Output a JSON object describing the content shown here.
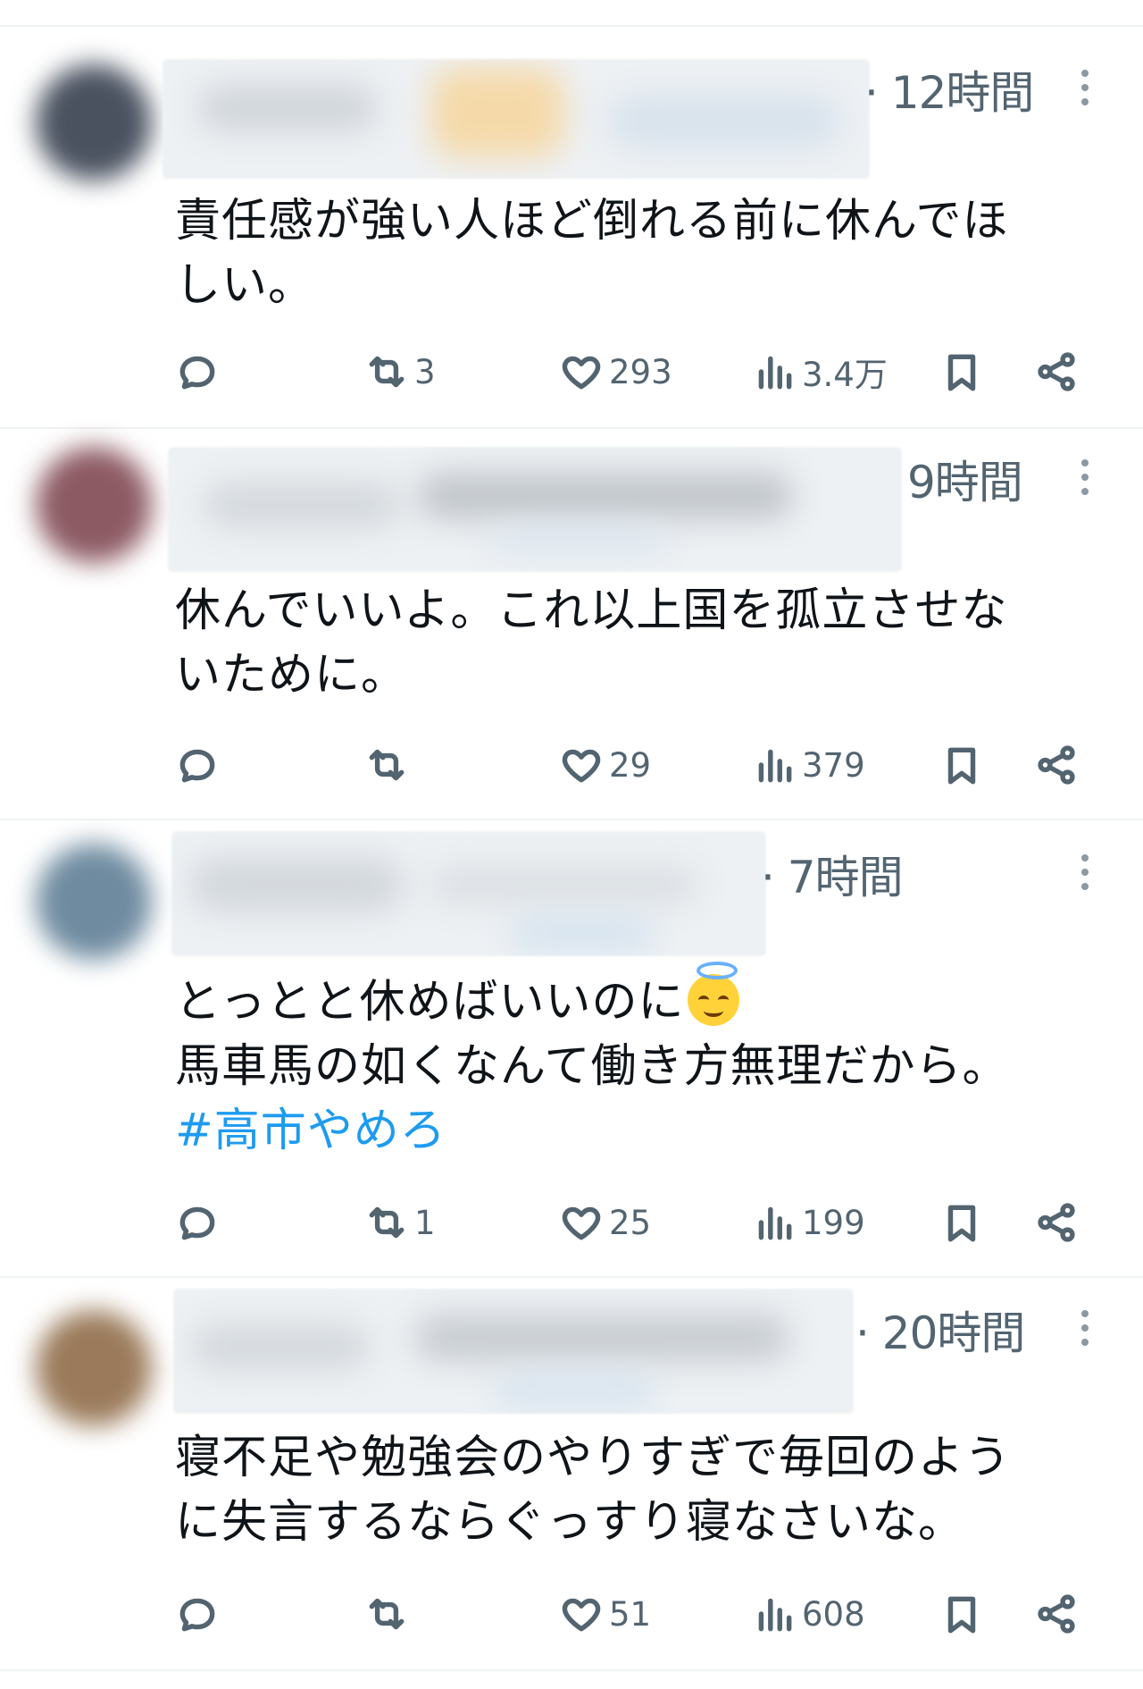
{
  "tweets": [
    {
      "time": "· 12時間",
      "lines": [
        "責任感が強い人ほど倒れる前に休んでほ",
        "しい。"
      ],
      "hashtag": "",
      "replies": "",
      "retweets": "3",
      "likes": "293",
      "views": "3.4万"
    },
    {
      "time": "9時間",
      "lines": [
        "休んでいいよ。これ以上国を孤立させな",
        "いために。"
      ],
      "hashtag": "",
      "replies": "",
      "retweets": "",
      "likes": "29",
      "views": "379"
    },
    {
      "time": "· 7時間",
      "lines": [
        "とっとと休めばいいのに",
        "馬車馬の如くなんて働き方無理だから。"
      ],
      "emoji": "smiling-face-with-halo",
      "hashtag": "#高市やめろ",
      "replies": "",
      "retweets": "1",
      "likes": "25",
      "views": "199"
    },
    {
      "time": "· 20時間",
      "lines": [
        "寝不足や勉強会のやりすぎで毎回のよう",
        "に失言するならぐっすり寝なさいな。"
      ],
      "hashtag": "",
      "replies": "",
      "retweets": "",
      "likes": "51",
      "views": "608"
    }
  ],
  "icons": {
    "reply": "reply-icon",
    "retweet": "retweet-icon",
    "like": "heart-icon",
    "views": "views-bar-chart-icon",
    "bookmark": "bookmark-icon",
    "share": "share-icon",
    "more": "more-options-icon"
  },
  "colors": {
    "text": "#0f1419",
    "secondary": "#536471",
    "hashtag": "#1d9bf0",
    "divider": "#eff3f4"
  }
}
